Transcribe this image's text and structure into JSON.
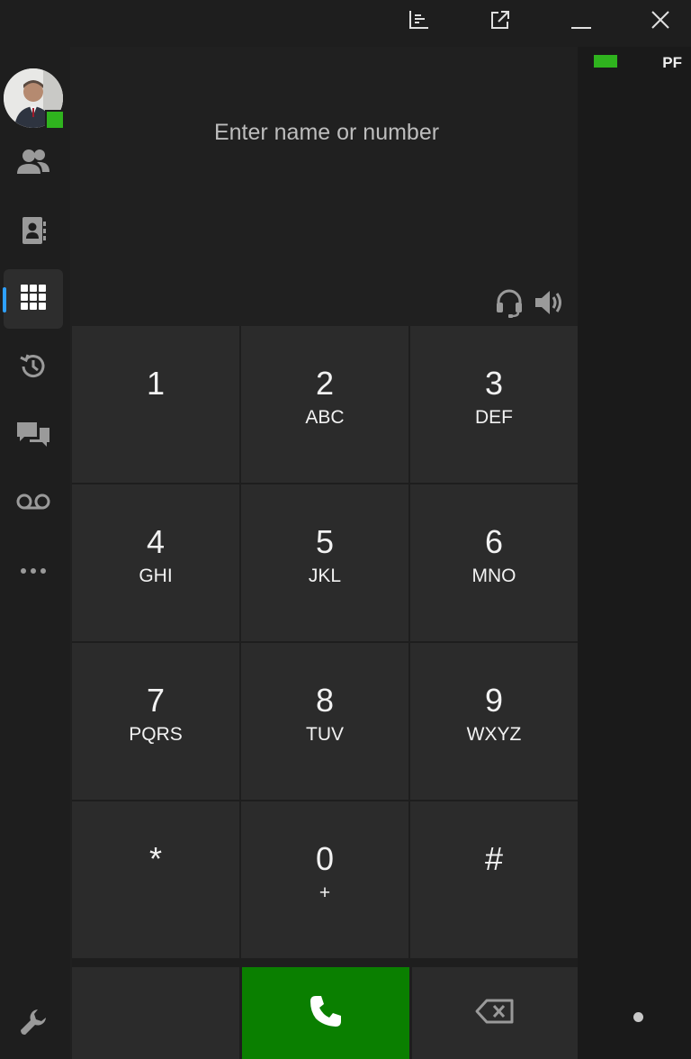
{
  "titlebar": {
    "icons": [
      "chart-icon",
      "popout-icon",
      "minimize-icon",
      "close-icon"
    ]
  },
  "nav": {
    "items": [
      {
        "name": "contacts",
        "icon": "people-icon",
        "active": false
      },
      {
        "name": "directory",
        "icon": "address-book-icon",
        "active": false
      },
      {
        "name": "dialpad",
        "icon": "dialpad-icon",
        "active": true
      },
      {
        "name": "history",
        "icon": "history-icon",
        "active": false
      },
      {
        "name": "chat",
        "icon": "chat-icon",
        "active": false
      },
      {
        "name": "voicemail",
        "icon": "voicemail-icon",
        "active": false
      },
      {
        "name": "more",
        "icon": "more-icon",
        "active": false
      }
    ],
    "settings_icon": "wrench-icon",
    "presence_color": "#2fb31e"
  },
  "dialer": {
    "placeholder": "Enter name or number",
    "value": ""
  },
  "keypad": {
    "keys": [
      {
        "digit": "1",
        "letters": ""
      },
      {
        "digit": "2",
        "letters": "ABC"
      },
      {
        "digit": "3",
        "letters": "DEF"
      },
      {
        "digit": "4",
        "letters": "GHI"
      },
      {
        "digit": "5",
        "letters": "JKL"
      },
      {
        "digit": "6",
        "letters": "MNO"
      },
      {
        "digit": "7",
        "letters": "PQRS"
      },
      {
        "digit": "8",
        "letters": "TUV"
      },
      {
        "digit": "9",
        "letters": "WXYZ"
      },
      {
        "digit": "*",
        "letters": ""
      },
      {
        "digit": "0",
        "letters": "+"
      },
      {
        "digit": "#",
        "letters": ""
      }
    ]
  },
  "actions": {
    "call_color": "#0a7f00"
  },
  "right_panel": {
    "initials": "PF",
    "status_color": "#2fb31e"
  }
}
